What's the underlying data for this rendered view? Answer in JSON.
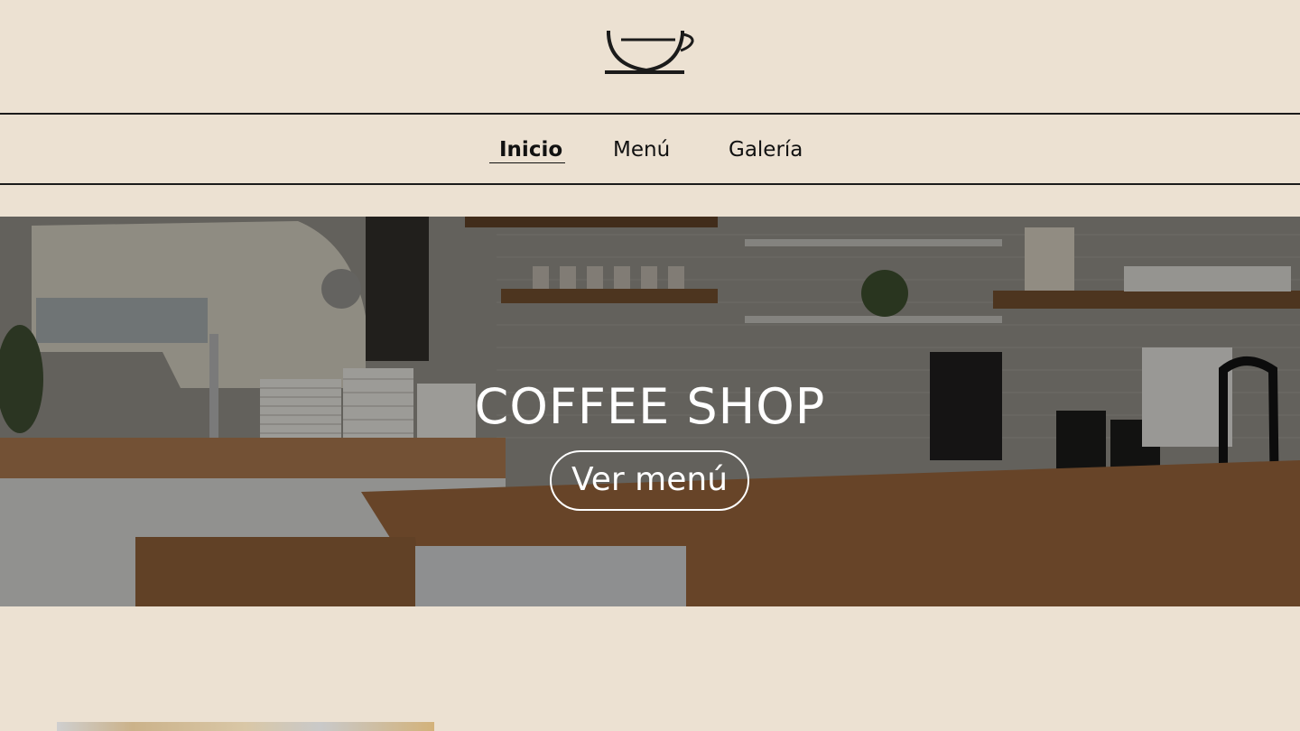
{
  "header": {
    "logo_icon": "coffee-cup-icon"
  },
  "nav": {
    "items": [
      {
        "label": "Inicio",
        "active": true
      },
      {
        "label": "Menú",
        "active": false
      },
      {
        "label": "Galería",
        "active": false
      }
    ]
  },
  "hero": {
    "title": "COFFEE SHOP",
    "button_label": "Ver menú"
  },
  "colors": {
    "background": "#ece1d2",
    "text": "#111111",
    "hero_text": "#ffffff"
  }
}
